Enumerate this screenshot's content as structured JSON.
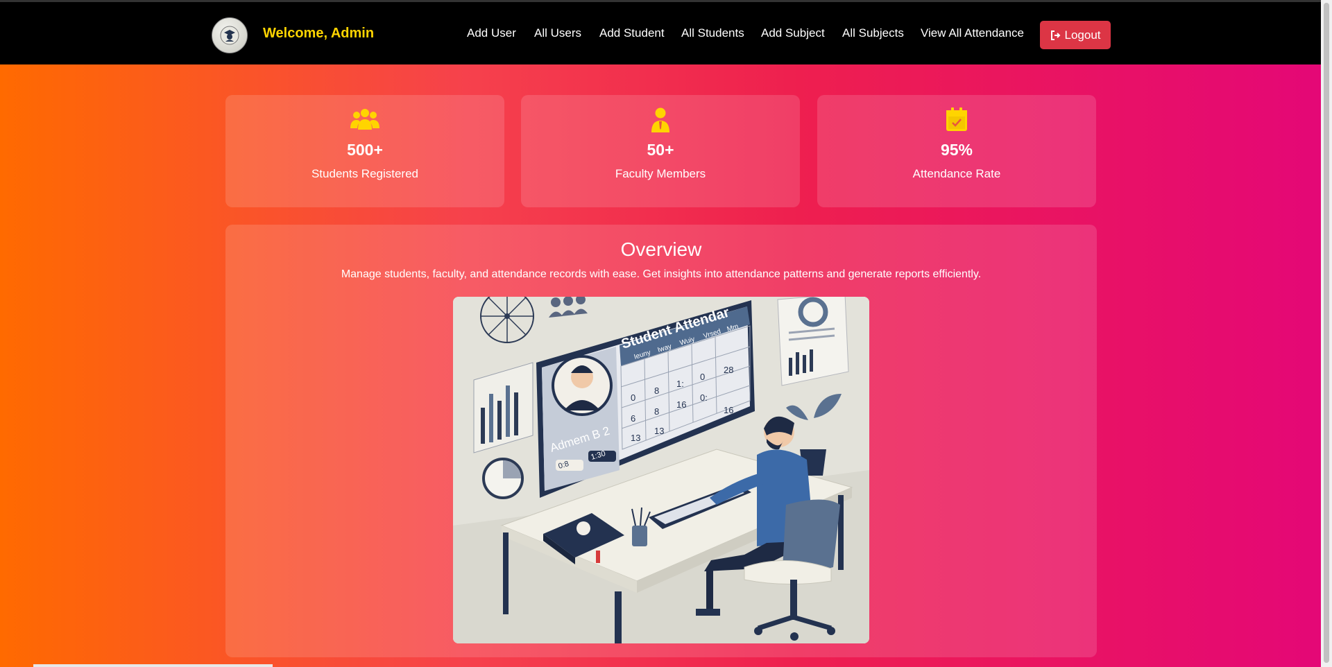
{
  "header": {
    "welcome": "Welcome, Admin",
    "nav": [
      "Add User",
      "All Users",
      "Add Student",
      "All Students",
      "Add Subject",
      "All Subjects",
      "View All Attendance"
    ],
    "logout_label": "Logout"
  },
  "stats": [
    {
      "icon": "users-group-icon",
      "value": "500+",
      "label": "Students Registered"
    },
    {
      "icon": "faculty-person-icon",
      "value": "50+",
      "label": "Faculty Members"
    },
    {
      "icon": "calendar-check-icon",
      "value": "95%",
      "label": "Attendance Rate"
    }
  ],
  "overview": {
    "title": "Overview",
    "description": "Manage students, faculty, and attendance records with ease. Get insights into attendance patterns and generate reports efficiently.",
    "illustration": {
      "screen_title": "Student Attendar",
      "day_headers": [
        "Ieuny",
        "Iway",
        "Wuiy",
        "Vrsed",
        "Mm"
      ],
      "cells": [
        "0",
        "8",
        "1:",
        "0",
        "28",
        "6",
        "8",
        "16",
        "0:",
        "",
        "13",
        "13",
        "",
        "",
        "16"
      ],
      "profile_name": "Admem B 2",
      "chip_a": "0:8",
      "chip_b": "1:30"
    }
  },
  "colors": {
    "accent": "#ffd400",
    "logout": "#dc3545",
    "navbar": "#000000",
    "gradient_start": "#ff6a00",
    "gradient_end": "#e40777"
  }
}
